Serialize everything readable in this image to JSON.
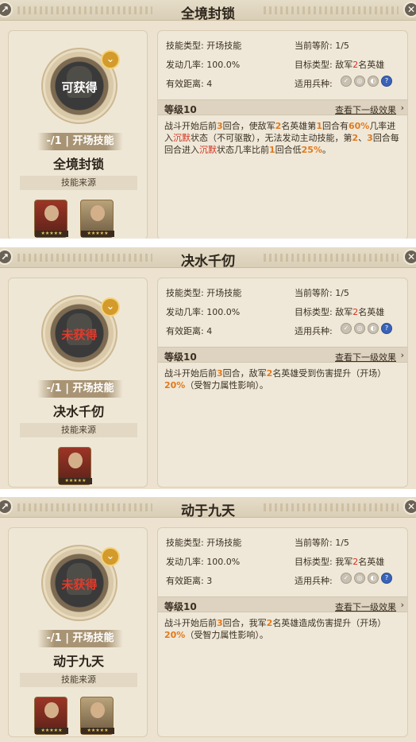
{
  "panels": [
    {
      "title": "全境封锁",
      "status": "可获得",
      "tag": "-/1 | 开场技能",
      "name": "全境封锁",
      "source_label": "技能来源",
      "heroes": 2,
      "info": {
        "type_label": "技能类型:",
        "type_value": "开场技能",
        "rank_label": "当前等阶:",
        "rank_value": "1/5",
        "rate_label": "发动几率:",
        "rate_value": "100.0%",
        "target_label": "目标类型:",
        "target_pre": "敌军",
        "target_num": "2",
        "target_post": "名英雄",
        "range_label": "有效距离:",
        "range_value": "4",
        "unit_label": "适用兵种:"
      },
      "level": "等级10",
      "next": "查看下一级效果",
      "desc": [
        {
          "t": "战斗开始后前"
        },
        {
          "t": "3",
          "c": "o"
        },
        {
          "t": "回合，使敌军"
        },
        {
          "t": "2",
          "c": "o"
        },
        {
          "t": "名英雄第"
        },
        {
          "t": "1",
          "c": "o"
        },
        {
          "t": "回合有"
        },
        {
          "t": "60%",
          "c": "o"
        },
        {
          "t": "几率进入"
        },
        {
          "t": "沉默",
          "c": "r"
        },
        {
          "t": "状态（不可驱散），无法发动主动技能，第"
        },
        {
          "t": "2",
          "c": "o"
        },
        {
          "t": "、"
        },
        {
          "t": "3",
          "c": "o"
        },
        {
          "t": "回合每回合进入"
        },
        {
          "t": "沉默",
          "c": "r"
        },
        {
          "t": "状态几率比前"
        },
        {
          "t": "1",
          "c": "o"
        },
        {
          "t": "回合低"
        },
        {
          "t": "25%",
          "c": "o"
        },
        {
          "t": "。"
        }
      ]
    },
    {
      "title": "决水千仞",
      "status": "未获得",
      "tag": "-/1 | 开场技能",
      "name": "决水千仞",
      "source_label": "技能来源",
      "heroes": 1,
      "info": {
        "type_label": "技能类型:",
        "type_value": "开场技能",
        "rank_label": "当前等阶:",
        "rank_value": "1/5",
        "rate_label": "发动几率:",
        "rate_value": "100.0%",
        "target_label": "目标类型:",
        "target_pre": "敌军",
        "target_num": "2",
        "target_post": "名英雄",
        "range_label": "有效距离:",
        "range_value": "4",
        "unit_label": "适用兵种:"
      },
      "level": "等级10",
      "next": "查看下一级效果",
      "desc": [
        {
          "t": "战斗开始后前"
        },
        {
          "t": "3",
          "c": "o"
        },
        {
          "t": "回合，敌军"
        },
        {
          "t": "2",
          "c": "o"
        },
        {
          "t": "名英雄受到伤害提升（开场）"
        },
        {
          "t": "20%",
          "c": "o"
        },
        {
          "t": "（受智力属性影响）。"
        }
      ]
    },
    {
      "title": "动于九天",
      "status": "未获得",
      "tag": "-/1 | 开场技能",
      "name": "动于九天",
      "source_label": "技能来源",
      "heroes": 2,
      "info": {
        "type_label": "技能类型:",
        "type_value": "开场技能",
        "rank_label": "当前等阶:",
        "rank_value": "1/5",
        "rate_label": "发动几率:",
        "rate_value": "100.0%",
        "target_label": "目标类型:",
        "target_pre": "我军",
        "target_num": "2",
        "target_post": "名英雄",
        "range_label": "有效距离:",
        "range_value": "3",
        "unit_label": "适用兵种:"
      },
      "level": "等级10",
      "next": "查看下一级效果",
      "desc": [
        {
          "t": "战斗开始后前"
        },
        {
          "t": "3",
          "c": "o"
        },
        {
          "t": "回合，我军"
        },
        {
          "t": "2",
          "c": "o"
        },
        {
          "t": "名英雄造成伤害提升（开场）"
        },
        {
          "t": "20%",
          "c": "o"
        },
        {
          "t": "（受智力属性影响）。"
        }
      ]
    }
  ]
}
